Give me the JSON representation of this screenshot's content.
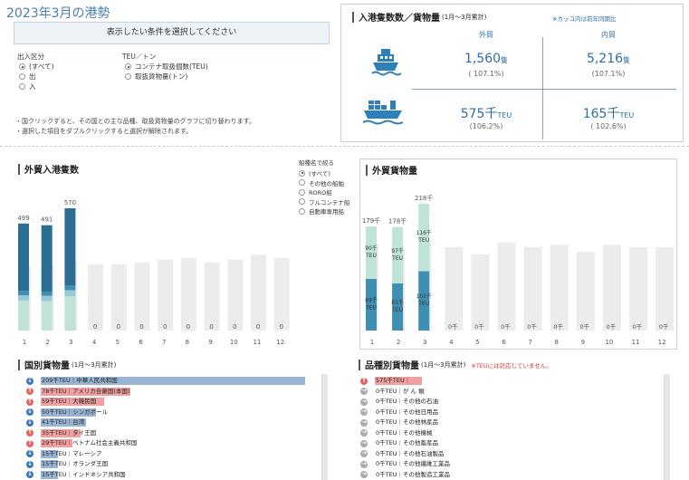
{
  "page_title": "2023年3月の港勢",
  "condition_box": "表示したい条件を選択してください",
  "filters": {
    "inout_label": "出入区分",
    "inout_options": [
      "(すべて)",
      "出",
      "入"
    ],
    "inout_selected": 0,
    "teu_label": "TEU／トン",
    "teu_options": [
      "コンテナ取扱個数(TEU)",
      "取扱貨物量(トン)"
    ],
    "teu_selected": 0
  },
  "notes": [
    "・国クリックすると、その国との主な品種、取扱貨物量のグラフに切り替わります。",
    "・選択した項目をダブルクリックすると選択が解除されます。"
  ],
  "summary": {
    "title": "入港隻数数／貨物量",
    "subtitle": "(1月～3月累計)",
    "note": "※カッコ内は前年同期比",
    "col_foreign": "外貿",
    "col_domestic": "内貿",
    "ship_icon": "ferry-icon",
    "cargo_icon": "cargo-ship-icon",
    "ships_foreign": "1,560",
    "ships_foreign_unit": "隻",
    "ships_foreign_pct": "( 107.1%)",
    "ships_domestic": "5,216",
    "ships_domestic_unit": "隻",
    "ships_domestic_pct": "(107.1%)",
    "cargo_foreign": "575千",
    "cargo_foreign_unit": "TEU",
    "cargo_foreign_pct": "(106.2%)",
    "cargo_domestic": "165千",
    "cargo_domestic_unit": "TEU",
    "cargo_domestic_pct": "( 102.6%)"
  },
  "ship_filter": {
    "label": "船種名で絞る",
    "options": [
      "(すべて)",
      "その他の船舶",
      "RORO船",
      "フルコンテナ船",
      "自動車専用船"
    ],
    "selected": 0
  },
  "chart_data": [
    {
      "type": "bar",
      "title": "外貿入港隻数",
      "categories": [
        "1",
        "2",
        "3",
        "4",
        "5",
        "6",
        "7",
        "8",
        "9",
        "10",
        "11",
        "12"
      ],
      "values": [
        499,
        491,
        570,
        0,
        0,
        0,
        0,
        0,
        0,
        0,
        0,
        0
      ],
      "value_labels": [
        "499",
        "491",
        "570",
        "0",
        "0",
        "0",
        "0",
        "0",
        "0",
        "0",
        "0",
        "0"
      ],
      "prev_year": [
        420,
        420,
        450,
        430,
        430,
        440,
        460,
        470,
        440,
        460,
        490,
        470
      ],
      "colors": {
        "main": "#2c6e93",
        "mid": "#3f8fb2",
        "light": "#9cc7d6",
        "pale": "#bfe4d6",
        "prev": "#ececec"
      }
    },
    {
      "type": "bar",
      "title": "外貿貨物量",
      "categories": [
        "1",
        "2",
        "3",
        "4",
        "5",
        "6",
        "7",
        "8",
        "9",
        "10",
        "11",
        "12"
      ],
      "top_labels": [
        "179千",
        "178千",
        "218千",
        "0千",
        "0千",
        "0千",
        "0千",
        "0千",
        "0千",
        "0千",
        "0千",
        "0千"
      ],
      "totals": [
        179,
        178,
        218,
        0,
        0,
        0,
        0,
        0,
        0,
        0,
        0,
        0
      ],
      "export": [
        90,
        97,
        116
      ],
      "export_labels": [
        "90千\nTEU",
        "97千\nTEU",
        "116千\nTEU"
      ],
      "import": [
        89,
        81,
        102
      ],
      "import_labels": [
        "89千\nTEU",
        "81千\nTEU",
        "102千\nTEU"
      ],
      "prev_year": [
        180,
        170,
        190,
        175,
        160,
        185,
        175,
        180,
        165,
        180,
        175,
        175
      ],
      "colors": {
        "export": "#bfe4d6",
        "import": "#3f8fb2",
        "prev": "#ececec"
      }
    }
  ],
  "country_list": {
    "title": "国別貨物量",
    "subtitle": "(1月～3月累計)",
    "items": [
      {
        "dir": "down",
        "label": "209千TEU｜中華人民共和国",
        "ratio": 1.0
      },
      {
        "dir": "up",
        "label": "78千TEU｜アメリカ合衆国(本国)",
        "ratio": 0.34
      },
      {
        "dir": "up",
        "label": "59千TEU｜大韓民国",
        "ratio": 0.24
      },
      {
        "dir": "down",
        "label": "50千TEU｜シンガポール",
        "ratio": 0.21
      },
      {
        "dir": "down",
        "label": "41千TEU｜台湾",
        "ratio": 0.17
      },
      {
        "dir": "up",
        "label": "35千TEU｜タイ王国",
        "ratio": 0.15
      },
      {
        "dir": "up",
        "label": "29千TEU｜ベトナム社会主義共和国",
        "ratio": 0.12
      },
      {
        "dir": "down",
        "label": "15千TEU｜マレーシア",
        "ratio": 0.065
      },
      {
        "dir": "down",
        "label": "15千TEU｜オランダ王国",
        "ratio": 0.065
      },
      {
        "dir": "down",
        "label": "15千TEU｜インドネシア共和国",
        "ratio": 0.065
      }
    ]
  },
  "commodity_list": {
    "title": "品種別貨物量",
    "subtitle": "(1月～3月累計)",
    "warning": "※TEUには対応していません。",
    "items": [
      {
        "dir": "up",
        "label": "575千TEU｜",
        "ratio": 1.0
      },
      {
        "dir": "right",
        "label": "0千TEU｜が ん 類",
        "ratio": 0
      },
      {
        "dir": "right",
        "label": "0千TEU｜その他の石油",
        "ratio": 0
      },
      {
        "dir": "right",
        "label": "0千TEU｜その他日用品",
        "ratio": 0
      },
      {
        "dir": "right",
        "label": "0千TEU｜その他林産品",
        "ratio": 0
      },
      {
        "dir": "right",
        "label": "0千TEU｜その他機械",
        "ratio": 0
      },
      {
        "dir": "right",
        "label": "0千TEU｜その他畜産品",
        "ratio": 0
      },
      {
        "dir": "right",
        "label": "0千TEU｜その他石油製品",
        "ratio": 0
      },
      {
        "dir": "right",
        "label": "0千TEU｜その他繊維工業品",
        "ratio": 0
      },
      {
        "dir": "right",
        "label": "0千TEU｜その他製造工業品",
        "ratio": 0
      }
    ]
  }
}
